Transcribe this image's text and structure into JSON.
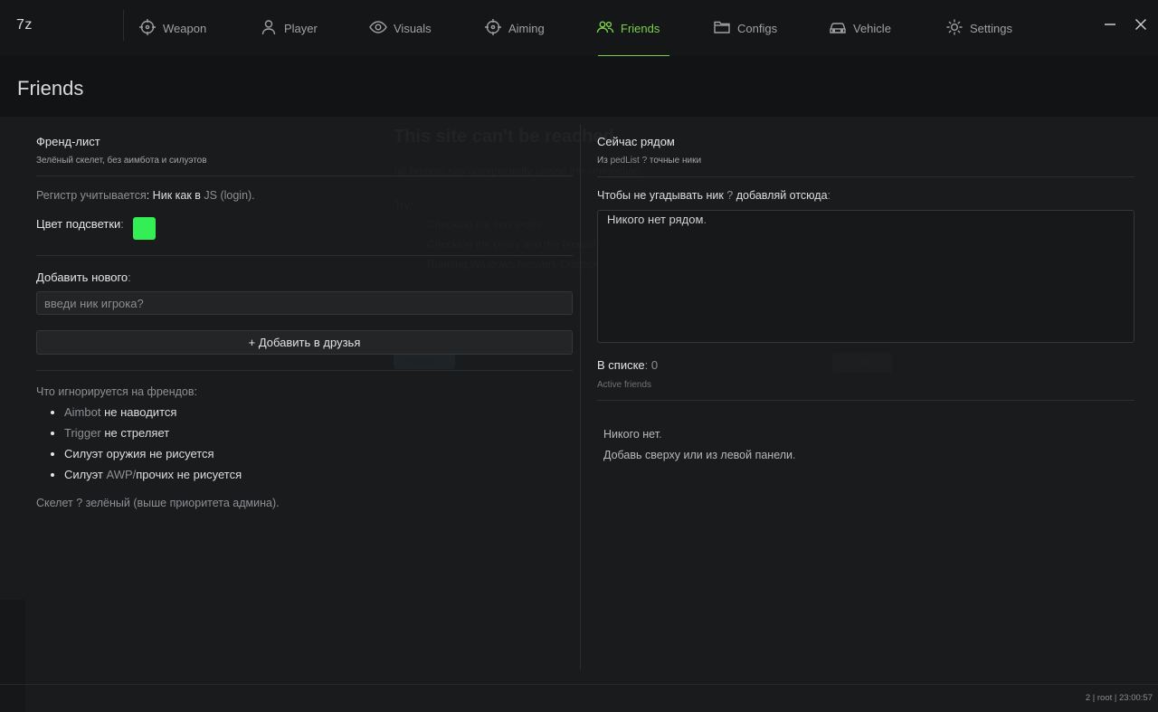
{
  "app": {
    "logo": "7z",
    "accent": "#7cd04b"
  },
  "tabs": [
    {
      "label": "Weapon",
      "icon": "crosshair-icon"
    },
    {
      "label": "Player",
      "icon": "person-icon"
    },
    {
      "label": "Visuals",
      "icon": "eye-icon"
    },
    {
      "label": "Aiming",
      "icon": "crosshair-icon"
    },
    {
      "label": "Friends",
      "icon": "people-icon",
      "active": true
    },
    {
      "label": "Configs",
      "icon": "folder-icon"
    },
    {
      "label": "Vehicle",
      "icon": "car-icon"
    },
    {
      "label": "Settings",
      "icon": "gear-icon"
    }
  ],
  "page": {
    "title": "Friends"
  },
  "ghost": {
    "title": "This site can't be reached",
    "lines": [
      "u8.hrspots.site unexpectedly closed the connection.",
      "Try:",
      "Checking the connection",
      "Checking the proxy and the firewall",
      "Running Windows Network Diagnostics"
    ],
    "button": "Reload",
    "button2": "Details"
  },
  "left": {
    "friendlist_title": "Френд-лист",
    "friendlist_sub": "Зелёный скелет, без аимбота и силуэтов",
    "case_note_a": "Регистр учитывается",
    "case_note_b": ": Ник как в ",
    "case_note_c": "JS (login).",
    "color_label": "Цвет подсветки",
    "color_colon": ":",
    "highlight_color": "#33ee55",
    "add_label": "Добавить нового",
    "add_colon": ":",
    "input_placeholder": "введи ник игрока?",
    "add_button": "+ Добавить в друзья",
    "ignored_title": "Что игнорируется на френдов:",
    "ignored": [
      {
        "a": "Aimbot",
        "b": " не наводится"
      },
      {
        "a": "Trigger",
        "b": " не стреляет"
      },
      {
        "a": "",
        "b": "Силуэт оружия не рисуется"
      },
      {
        "a": "AWP/",
        "b": "прочих не рисуется",
        "pre": "Силуэт "
      }
    ],
    "skeleton_a": "Скелет ",
    "skeleton_b": "? зелёный (выше приоритета админа)."
  },
  "right": {
    "nearby_title": "Сейчас рядом",
    "nearby_sub_a": "Из ",
    "nearby_sub_b": "pedList ?",
    "nearby_sub_c": " точные ники",
    "hint_a": "Чтобы не угадывать ник ",
    "hint_b": "?",
    "hint_c": " добавляй отсюда",
    "hint_d": ":",
    "nearby_empty": "Никого нет рядом",
    "nearby_empty_dot": ".",
    "list_label": "В списке",
    "list_colon": ":",
    "list_count": "0",
    "list_sub": "Active friends",
    "empty_a": "Никого нет",
    "empty_a_dot": ".",
    "empty_b": "Добавь сверху или из левой панели",
    "empty_b_dot": "."
  },
  "status": {
    "text": "2 | root | 23:00:57"
  }
}
